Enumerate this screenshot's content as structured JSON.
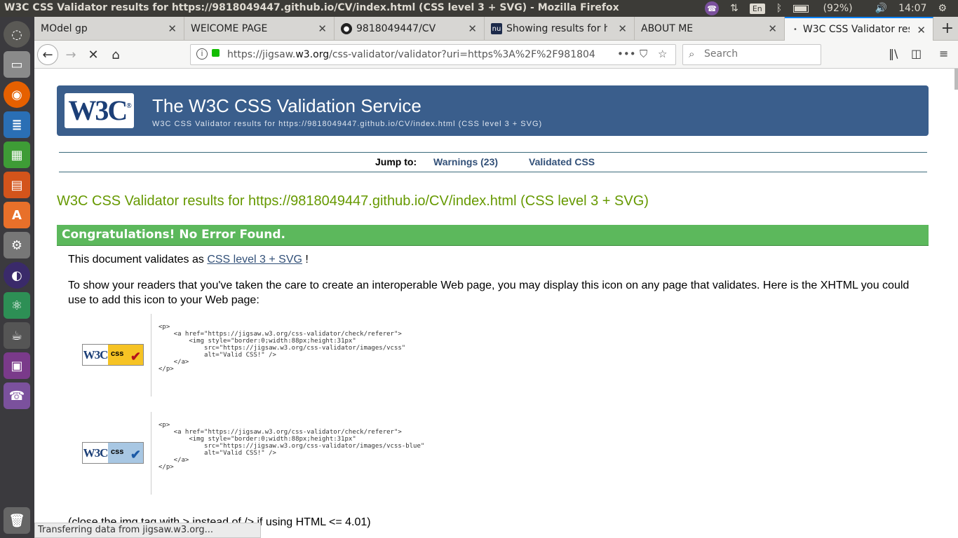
{
  "window": {
    "title": "W3C CSS Validator results for https://9818049447.github.io/CV/index.html (CSS level 3 + SVG) - Mozilla Firefox",
    "lang": "En",
    "battery": "(92%)",
    "time": "14:07"
  },
  "tabs": [
    {
      "label": "MOdel gp",
      "active": false
    },
    {
      "label": "WElCOME PAGE",
      "active": false
    },
    {
      "label": "9818049447/CV",
      "active": false
    },
    {
      "label": "Showing results for ht",
      "active": false
    },
    {
      "label": "ABOUT ME",
      "active": false
    },
    {
      "label": "W3C CSS Validator res",
      "active": true
    }
  ],
  "navbar": {
    "url_prefix": "https://jigsaw.",
    "url_domain": "w3.org",
    "url_rest": "/css-validator/validator?uri=https%3A%2F%2F981804",
    "search_placeholder": "Search"
  },
  "page": {
    "banner_title": "The W3C CSS Validation Service",
    "banner_subtitle": "W3C CSS Validator results for https://9818049447.github.io/CV/index.html (CSS level 3 + SVG)",
    "jump_label": "Jump to:",
    "jump_warnings": "Warnings (23)",
    "jump_validated": "Validated CSS",
    "results_title": "W3C CSS Validator results for https://9818049447.github.io/CV/index.html (CSS level 3 + SVG)",
    "congrats": "Congratulations! No Error Found.",
    "validates_prefix": "This document validates as ",
    "validates_link": "CSS level 3 + SVG",
    "validates_suffix": " !",
    "show_text": "To show your readers that you've taken the care to create an interoperable Web page, you may display this icon on any page that validates. Here is the XHTML you could use to add this icon to your Web page:",
    "code1": "<p>\n    <a href=\"https://jigsaw.w3.org/css-validator/check/referer\">\n        <img style=\"border:0;width:88px;height:31px\"\n            src=\"https://jigsaw.w3.org/css-validator/images/vcss\"\n            alt=\"Valid CSS!\" />\n    </a>\n</p>",
    "code2": "<p>\n    <a href=\"https://jigsaw.w3.org/css-validator/check/referer\">\n        <img style=\"border:0;width:88px;height:31px\"\n            src=\"https://jigsaw.w3.org/css-validator/images/vcss-blue\"\n            alt=\"Valid CSS!\" />\n    </a>\n</p>",
    "badge_w3c": "W3C",
    "badge_css": "css",
    "close_note": "(close the img tag with > instead of /> if using HTML <= 4.01)"
  },
  "status": "Transferring data from jigsaw.w3.org...",
  "colors": {
    "banner": "#3a5e8c",
    "congrats": "#5cb85c",
    "results_title": "#669900",
    "badge_gold": "#f6c324",
    "badge_blue": "#a8c7e3"
  }
}
